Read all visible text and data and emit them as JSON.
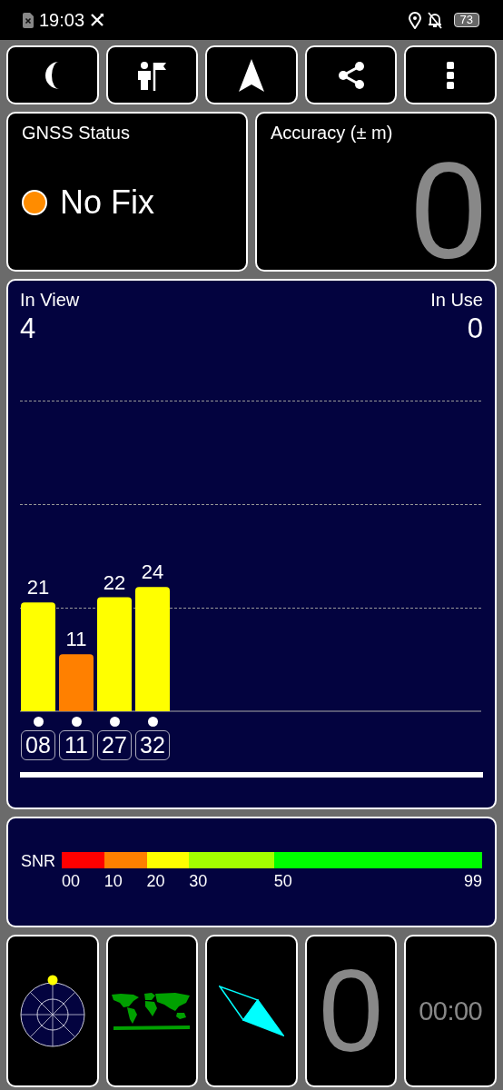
{
  "status_bar": {
    "time": "19:03",
    "battery": "73"
  },
  "toolbar": [
    {
      "kind": "night"
    },
    {
      "kind": "person-flag"
    },
    {
      "kind": "navigation"
    },
    {
      "kind": "share"
    },
    {
      "kind": "more"
    }
  ],
  "gnss_status": {
    "title": "GNSS Status",
    "fix": "No Fix",
    "fixed": false
  },
  "accuracy": {
    "title": "Accuracy (± m)",
    "value": "0"
  },
  "satellites": {
    "in_view_label": "In View",
    "in_view": "4",
    "in_use_label": "In Use",
    "in_use": "0",
    "chart_data": {
      "type": "bar",
      "categories": [
        "08",
        "11",
        "27",
        "32"
      ],
      "values": [
        21,
        11,
        22,
        24
      ],
      "data_labels": true
    },
    "dots": [
      {
        "shown": true
      },
      {
        "shown": true
      },
      {
        "shown": true
      },
      {
        "shown": true
      }
    ]
  },
  "snr_legend": {
    "label": "SNR",
    "segments": [
      {
        "label": "00",
        "color": "#ff0000"
      },
      {
        "label": "10",
        "color": "#ff8000"
      },
      {
        "label": "20",
        "color": "#ffff00"
      },
      {
        "label": "30",
        "color": "#a4ff00"
      },
      {
        "label": "50",
        "color": "#00ff00"
      }
    ],
    "end_label": "99"
  },
  "tiles": [
    {
      "kind": "sky"
    },
    {
      "kind": "map"
    },
    {
      "kind": "compass"
    },
    {
      "kind": "number",
      "text": "0"
    },
    {
      "kind": "timer",
      "text": "00:00"
    }
  ]
}
